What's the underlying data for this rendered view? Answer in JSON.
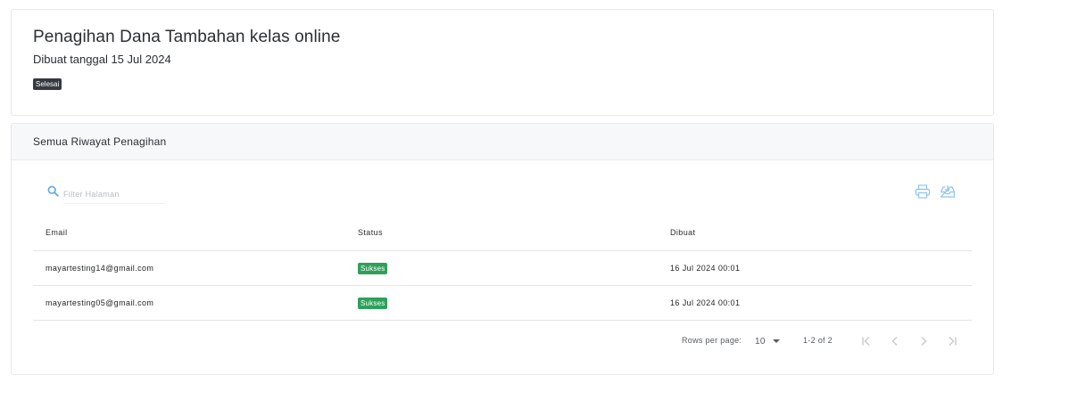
{
  "header": {
    "title": "Penagihan Dana Tambahan kelas online",
    "subtitle": "Dibuat tanggal 15 Jul 2024",
    "status": "Selesai"
  },
  "history": {
    "title": "Semua Riwayat Penagihan",
    "search": {
      "placeholder": "Filter Halaman",
      "value": ""
    },
    "tools": {
      "print_icon": "printer-icon",
      "download_icon": "inbox-download-icon"
    },
    "columns": [
      "Email",
      "Status",
      "Dibuat"
    ],
    "rows": [
      {
        "email": "mayartesting14@gmail.com",
        "status": "Sukses",
        "created": "16 Jul 2024 00:01"
      },
      {
        "email": "mayartesting05@gmail.com",
        "status": "Sukses",
        "created": "16 Jul 2024 00:01"
      }
    ],
    "pagination": {
      "rows_per_page_label": "Rows per page:",
      "rows_per_page": "10",
      "range": "1-2 of 2"
    }
  },
  "colors": {
    "success": "#2ea05a",
    "status_dark": "#343a40",
    "icon_accent": "#5aa9e6",
    "header_bg": "#f7f8fa",
    "border": "#e6e8eb"
  }
}
